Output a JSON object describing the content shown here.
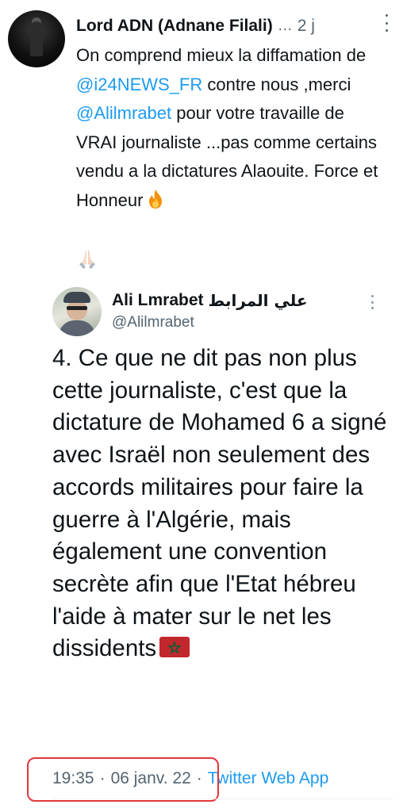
{
  "tweet": {
    "author_name": "Lord ADN (Adnane Filali)",
    "ellipsis": "…",
    "time_ago": "2 j",
    "text_parts": {
      "p1": "On comprend mieux la diffamation de ",
      "mention1": "@i24NEWS_FR",
      "p2": " contre nous ,merci ",
      "mention2": "@Alilmrabet",
      "p3": " pour votre travaille de VRAI journaliste ...pas comme certains vendu a la dictatures Alaouite. Force et Honneur"
    },
    "avatar_icon": "avatar-silhouette",
    "emojis": [
      "fire-emoji",
      "folded-hands-emoji"
    ]
  },
  "quoted": {
    "author_name": "Ali Lmrabet",
    "author_name_ar": "علي المرابط",
    "handle": "@Alilmrabet",
    "text": "4. Ce que ne dit pas non plus cette journaliste, c'est que la dictature de Mohamed 6 a signé avec Israël non seulement des accords militaires pour faire la guerre à l'Algérie, mais également une convention secrète afin que l'Etat hébreu l'aide à mater sur le net les dissidents",
    "emoji": "morocco-flag-emoji"
  },
  "footer": {
    "time": "19:35",
    "separator": "·",
    "date": "06 janv. 22",
    "app": "Twitter Web App"
  },
  "colors": {
    "link": "#1d9bf0",
    "secondary_text": "#536471",
    "highlight_border": "#e0363c"
  }
}
